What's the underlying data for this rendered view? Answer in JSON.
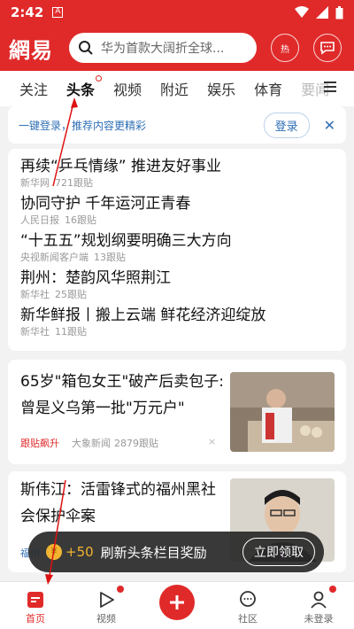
{
  "status": {
    "time": "2:42",
    "notif": "A"
  },
  "header": {
    "logo": "網易",
    "search_placeholder": "华为首款大阔折全球...",
    "hot_label": "热"
  },
  "tabs": [
    "关注",
    "头条",
    "视频",
    "附近",
    "娱乐",
    "体育",
    "要闻"
  ],
  "active_tab": "头条",
  "login_bar": {
    "text": "一键登录，推荐内容更精彩",
    "button": "登录",
    "close": "✕"
  },
  "headlines": [
    {
      "title": "再续“乒乓情缘” 推进友好事业",
      "source": "新华网",
      "comments": "721跟贴"
    },
    {
      "title": "协同守护 千年运河正青春",
      "source": "人民日报",
      "comments": "16跟贴"
    },
    {
      "title": "“十五五”规划纲要明确三大方向",
      "source": "央视新闻客户端",
      "comments": "13跟贴"
    },
    {
      "title": "荆州：楚韵风华照荆江",
      "source": "新华社",
      "comments": "25跟贴"
    },
    {
      "title": "新华鲜报丨搬上云端 鲜花经济迎绽放",
      "source": "新华社",
      "comments": "11跟贴"
    }
  ],
  "article1": {
    "title": "65岁\"箱包女王\"破产后卖包子:曾是义乌第一批\"万元户\"",
    "hot": "跟贴飙升",
    "source": "大象新闻",
    "comments": "2879跟贴",
    "close": "×"
  },
  "article2": {
    "title": "斯伟江：活雷锋式的福州黑社会保护伞案",
    "source_partial": "福州"
  },
  "reward": {
    "coin": "¥",
    "amount": "+50",
    "text": "刷新头条栏目奖励",
    "button": "立即领取"
  },
  "bottom_nav": [
    {
      "label": "首页",
      "icon": "home-icon"
    },
    {
      "label": "视频",
      "icon": "play-icon"
    },
    {
      "label": "",
      "icon": "plus-icon"
    },
    {
      "label": "社区",
      "icon": "chat-icon"
    },
    {
      "label": "未登录",
      "icon": "user-icon"
    }
  ],
  "colors": {
    "brand": "#e02a2a",
    "link": "#2f6fb5"
  }
}
